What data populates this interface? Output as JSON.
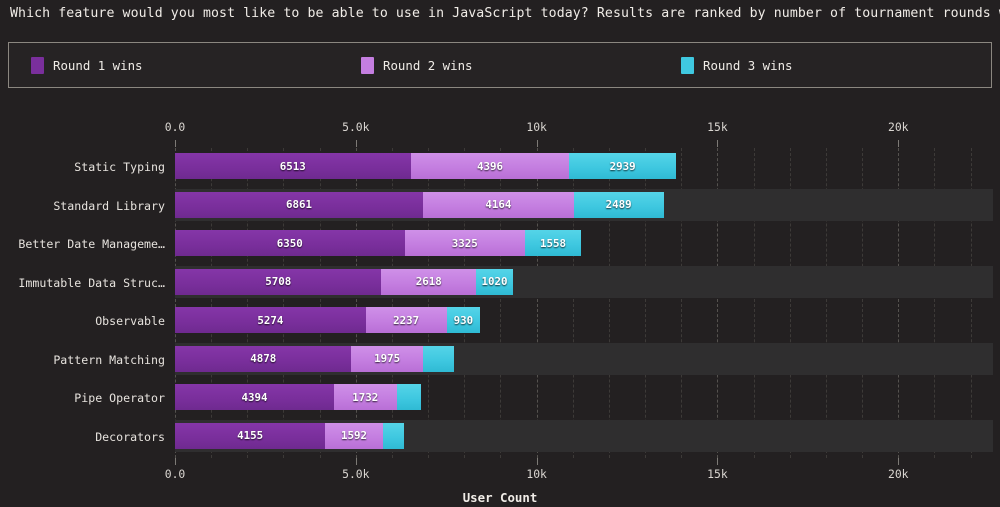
{
  "title": "Which feature would you most like to be able to use in JavaScript today? Results are ranked by number of tournament rounds won.",
  "legend": {
    "items": [
      {
        "label": "Round 1 wins",
        "color": "#7a2f9c"
      },
      {
        "label": "Round 2 wins",
        "color": "#c47ee0"
      },
      {
        "label": "Round 3 wins",
        "color": "#3fc8e0"
      }
    ]
  },
  "chart_data": {
    "type": "bar",
    "orientation": "horizontal",
    "stacked": true,
    "title": "Which feature would you most like to be able to use in JavaScript today? Results are ranked by number of tournament rounds won.",
    "xlabel": "User Count",
    "ylabel": "",
    "xlim": [
      0,
      22620
    ],
    "grid": true,
    "legend_position": "top",
    "xticks": [
      0,
      5000,
      10000,
      15000,
      20000
    ],
    "xticklabels": [
      "0.0",
      "5.0k",
      "10k",
      "15k",
      "20k"
    ],
    "categories": [
      "Static Typing",
      "Standard Library",
      "Better Date Manageme…",
      "Immutable Data Struc…",
      "Observable",
      "Pattern Matching",
      "Pipe Operator",
      "Decorators"
    ],
    "series": [
      {
        "name": "Round 1 wins",
        "color": "#7a2f9c",
        "values": [
          6513,
          6861,
          6350,
          5708,
          5274,
          4878,
          4394,
          4155
        ]
      },
      {
        "name": "Round 2 wins",
        "color": "#c47ee0",
        "values": [
          4396,
          4164,
          3325,
          2618,
          2237,
          1975,
          1732,
          1592
        ]
      },
      {
        "name": "Round 3 wins",
        "color": "#3fc8e0",
        "values": [
          2939,
          2489,
          1558,
          1020,
          930,
          857,
          690,
          580
        ]
      }
    ],
    "bar_labels": [
      [
        "6513",
        "4396",
        "2939"
      ],
      [
        "6861",
        "4164",
        "2489"
      ],
      [
        "6350",
        "3325",
        "1558"
      ],
      [
        "5708",
        "2618",
        "1020"
      ],
      [
        "5274",
        "2237",
        "930"
      ],
      [
        "4878",
        "1975",
        ""
      ],
      [
        "4394",
        "1732",
        ""
      ],
      [
        "4155",
        "1592",
        ""
      ]
    ]
  }
}
